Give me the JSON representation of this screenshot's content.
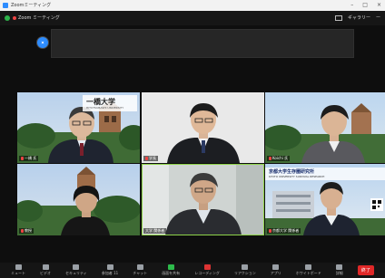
{
  "window": {
    "title": "Zoomミーティング",
    "min": "–",
    "max": "□",
    "close": "×"
  },
  "zoombar": {
    "label": "Zoom ミーティング",
    "view_label": "ギャラリー",
    "extra": "ー"
  },
  "participants": [
    {
      "name": "一橋 氏",
      "logo_text": "一橋大学",
      "logo_sub": "HITOTSUBASHI UNIVERSITY"
    },
    {
      "name": "学長"
    },
    {
      "name": "Koichi 氏"
    },
    {
      "name": "教授"
    },
    {
      "name": "大学 関係者"
    },
    {
      "name": "京都大学 関係者",
      "banner": "京都大学生存圏研究所",
      "banner_sub": "KYOTO UNIVERSITY SURVIVAL RESEARCH"
    }
  ],
  "toolbar": {
    "items": [
      {
        "label": "ミュート",
        "icon": "mic-icon"
      },
      {
        "label": "ビデオ",
        "icon": "video-icon"
      },
      {
        "label": "セキュリティ",
        "icon": "shield-icon"
      },
      {
        "label": "参加者 11",
        "icon": "participants-icon"
      },
      {
        "label": "チャット",
        "icon": "chat-icon"
      },
      {
        "label": "画面を共有",
        "icon": "share-screen-icon"
      },
      {
        "label": "レコーディング",
        "icon": "record-icon"
      },
      {
        "label": "リアクション",
        "icon": "reaction-icon"
      },
      {
        "label": "アプリ",
        "icon": "apps-icon"
      },
      {
        "label": "ホワイトボード",
        "icon": "whiteboard-icon"
      },
      {
        "label": "詳細",
        "icon": "more-icon"
      }
    ],
    "end": "終了"
  }
}
